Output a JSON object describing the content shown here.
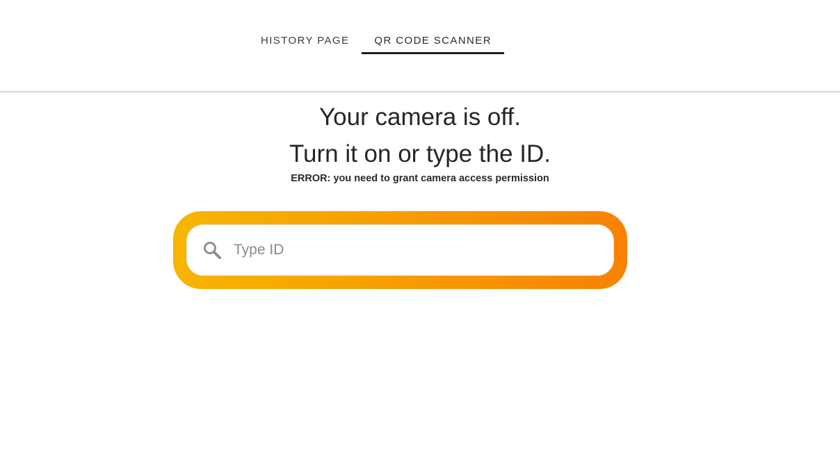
{
  "nav": {
    "tabs": [
      {
        "label": "HISTORY PAGE",
        "active": false
      },
      {
        "label": "QR CODE SCANNER",
        "active": true
      }
    ]
  },
  "main": {
    "headline_line1": "Your camera is off.",
    "headline_line2": "Turn it on or type the ID.",
    "error_prefix": "ERROR:",
    "error_message": "you need to grant camera access permission"
  },
  "search": {
    "placeholder": "Type ID",
    "value": "",
    "icon": "search-icon"
  },
  "colors": {
    "gradient_start": "#f7b500",
    "gradient_end": "#f98200",
    "active_tab_underline": "#1f1f1f"
  }
}
